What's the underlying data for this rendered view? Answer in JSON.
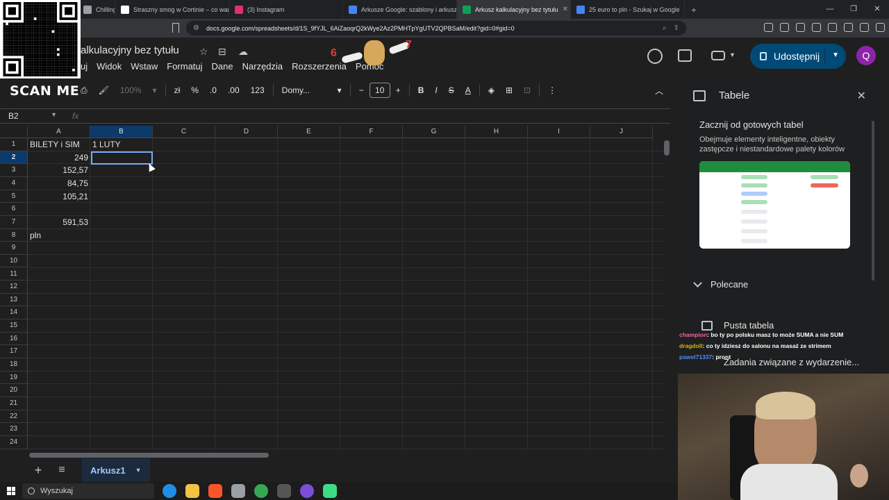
{
  "browser": {
    "tabs": [
      {
        "label": "Chilling (R",
        "color": "#c8c8c8",
        "active": false
      },
      {
        "label": "Straszny smog w Cortinie – co warto",
        "color": "#ffffff",
        "active": false
      },
      {
        "label": "(3) Instagram",
        "color": "#e1306c",
        "active": false
      },
      {
        "label": "Arkusze Google: szablony i arkusze k",
        "color": "#4285f4",
        "active": false
      },
      {
        "label": "Arkusz kalkulacyjny bez tytułu",
        "color": "#0f9d58",
        "active": true
      },
      {
        "label": "25 euro to pln - Szukaj w Google",
        "color": "#4285f4",
        "active": false
      }
    ],
    "url": "docs.google.com/spreadsheets/d/1S_9fYJL_6AiZaoqrQ2kWye2Az2PMHTpYgUTV2QPBSaM/edit?gid=0#gid=0"
  },
  "overlay": {
    "scan_label": "SCAN ME"
  },
  "sheets": {
    "title": "Arkusz kalkulacyjny bez tytułu",
    "title_visible": "alkulacyjny bez tytułu",
    "menu": [
      "uj",
      "Widok",
      "Wstaw",
      "Formatuj",
      "Dane",
      "Narzędzia",
      "Rozszerzenia",
      "Pomoc"
    ],
    "share_label": "Udostępnij",
    "avatar_letter": "Q",
    "toolbar": {
      "zoom": "100%",
      "currency": "zł",
      "percent": "%",
      "dec_decrease": ".0",
      "dec_increase": ".00",
      "number_format": "123",
      "font": "Domy...",
      "font_size": "10",
      "bold": "B",
      "italic": "I",
      "strike": "S",
      "text_color": "A"
    },
    "name_box": "B2",
    "fx_label": "fx",
    "columns": [
      "A",
      "B",
      "C",
      "D",
      "E",
      "F",
      "G",
      "H",
      "I",
      "J"
    ],
    "rows": [
      "1",
      "2",
      "3",
      "4",
      "5",
      "6",
      "7",
      "8",
      "9",
      "10",
      "11",
      "12",
      "13",
      "14",
      "15",
      "16",
      "17",
      "18",
      "19",
      "20",
      "21",
      "22",
      "23",
      "24"
    ],
    "cells": {
      "A1": "BILETY i SIM",
      "B1": "1 LUTY",
      "A2": "249",
      "A3": "152,57",
      "A4": "84,75",
      "A5": "105,21",
      "A7": "591,53",
      "A8": "pln"
    },
    "sheet_tab": "Arkusz1"
  },
  "panel": {
    "title": "Tabele",
    "heading": "Zacznij od gotowych tabel",
    "description": "Obejmuje elementy inteligentne, obiekty zastępcze i niestandardowe palety kolorów",
    "recommended": "Polecane",
    "empty_table": "Pusta tabela",
    "events": "Zadania związane z wydarzenie..."
  },
  "chat": [
    {
      "user": "champion",
      "message": ": bo ty po polsku masz to może SUMA a nie SUM"
    },
    {
      "user": "dragdoll",
      "message": ": co ty idziesz do salonu na masaż ze strimem"
    },
    {
      "user": "pawel71337",
      "message": ": pront"
    }
  ],
  "taskbar": {
    "search_label": "Wyszukaj"
  }
}
